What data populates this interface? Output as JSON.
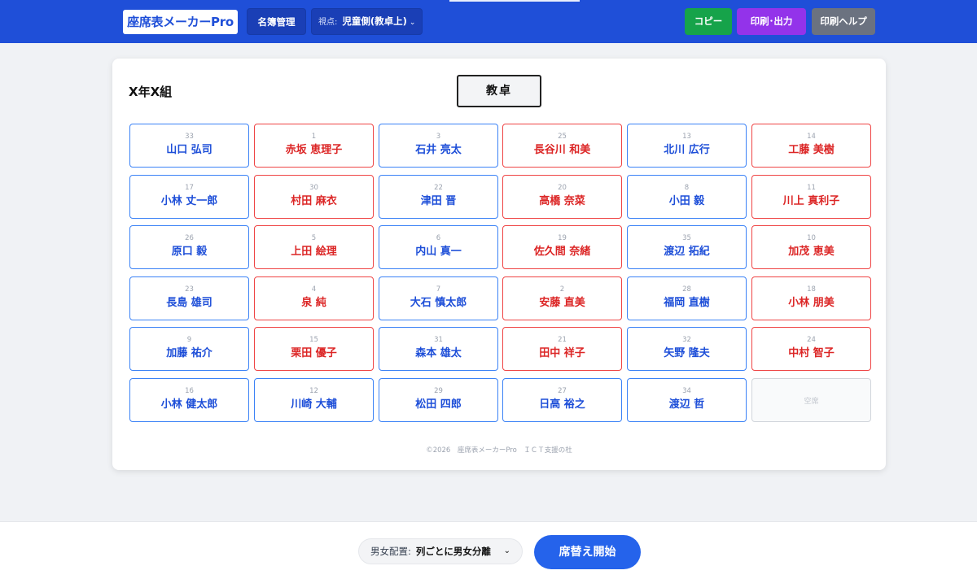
{
  "header": {
    "logo": "座席表メーカーPro",
    "roster_button": "名簿管理",
    "view_label": "視点:",
    "view_value": "児童側(教卓上)",
    "copy_button": "コピー",
    "print_button": "印刷･出力",
    "help_button": "印刷ヘルプ",
    "colors": {
      "bar": "#1f4fd8",
      "copy": "#16a34a",
      "print": "#9333ea",
      "help": "#6b7280"
    }
  },
  "main": {
    "class_name": "X年X組",
    "teacher_desk": "教卓",
    "seat_colors": {
      "male": "#3b82f6",
      "female": "#ef4444",
      "empty": "#d1d5db"
    },
    "seats": [
      [
        {
          "num": "33",
          "name": "山口 弘司",
          "gender": "male"
        },
        {
          "num": "1",
          "name": "赤坂 恵理子",
          "gender": "female"
        },
        {
          "num": "3",
          "name": "石井 亮太",
          "gender": "male"
        },
        {
          "num": "25",
          "name": "長谷川 和美",
          "gender": "female"
        },
        {
          "num": "13",
          "name": "北川 広行",
          "gender": "male"
        },
        {
          "num": "14",
          "name": "工藤 美樹",
          "gender": "female"
        }
      ],
      [
        {
          "num": "17",
          "name": "小林 丈一郎",
          "gender": "male"
        },
        {
          "num": "30",
          "name": "村田 麻衣",
          "gender": "female"
        },
        {
          "num": "22",
          "name": "津田 晋",
          "gender": "male"
        },
        {
          "num": "20",
          "name": "高橋 奈菜",
          "gender": "female"
        },
        {
          "num": "8",
          "name": "小田 毅",
          "gender": "male"
        },
        {
          "num": "11",
          "name": "川上 真利子",
          "gender": "female"
        }
      ],
      [
        {
          "num": "26",
          "name": "原口 毅",
          "gender": "male"
        },
        {
          "num": "5",
          "name": "上田 絵理",
          "gender": "female"
        },
        {
          "num": "6",
          "name": "内山 真一",
          "gender": "male"
        },
        {
          "num": "19",
          "name": "佐久間 奈緒",
          "gender": "female"
        },
        {
          "num": "35",
          "name": "渡辺 拓紀",
          "gender": "male"
        },
        {
          "num": "10",
          "name": "加茂 恵美",
          "gender": "female"
        }
      ],
      [
        {
          "num": "23",
          "name": "長島 雄司",
          "gender": "male"
        },
        {
          "num": "4",
          "name": "泉 純",
          "gender": "female"
        },
        {
          "num": "7",
          "name": "大石 慎太郎",
          "gender": "male"
        },
        {
          "num": "2",
          "name": "安藤 直美",
          "gender": "female"
        },
        {
          "num": "28",
          "name": "福岡 直樹",
          "gender": "male"
        },
        {
          "num": "18",
          "name": "小林 朋美",
          "gender": "female"
        }
      ],
      [
        {
          "num": "9",
          "name": "加藤 祐介",
          "gender": "male"
        },
        {
          "num": "15",
          "name": "栗田 優子",
          "gender": "female"
        },
        {
          "num": "31",
          "name": "森本 雄太",
          "gender": "male"
        },
        {
          "num": "21",
          "name": "田中 祥子",
          "gender": "female"
        },
        {
          "num": "32",
          "name": "矢野 隆夫",
          "gender": "male"
        },
        {
          "num": "24",
          "name": "中村 智子",
          "gender": "female"
        }
      ],
      [
        {
          "num": "16",
          "name": "小林 健太郎",
          "gender": "male"
        },
        {
          "num": "12",
          "name": "川崎 大輔",
          "gender": "male"
        },
        {
          "num": "29",
          "name": "松田 四郎",
          "gender": "male"
        },
        {
          "num": "27",
          "name": "日高 裕之",
          "gender": "male"
        },
        {
          "num": "34",
          "name": "渡辺 哲",
          "gender": "male"
        },
        {
          "num": "",
          "name": "空席",
          "gender": "empty"
        }
      ]
    ],
    "footer": "©2026　座席表メーカーPro　ＩＣＴ支援の杜"
  },
  "bottom": {
    "gender_label": "男女配置:",
    "gender_value": "列ごとに男女分離",
    "shuffle_button": "席替え開始"
  }
}
